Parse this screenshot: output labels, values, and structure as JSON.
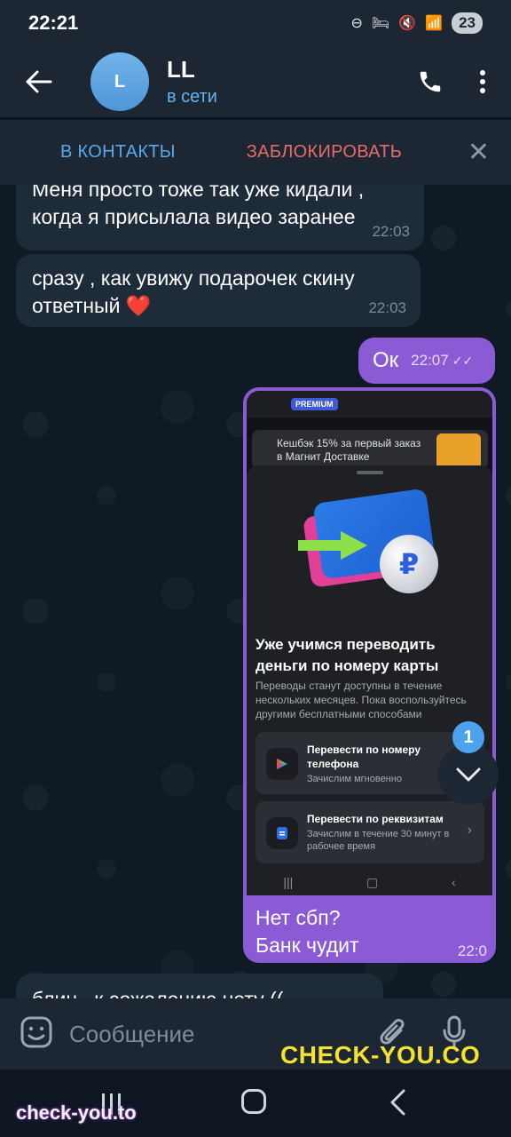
{
  "status_bar": {
    "time": "22:21",
    "battery": "23",
    "icons": [
      "do-not-disturb-icon",
      "bed-icon",
      "mute-icon",
      "wifi-icon",
      "signal-icon"
    ]
  },
  "header": {
    "avatar_letter": "L",
    "name": "LL",
    "status": "в сети",
    "accent": "#62b5f2"
  },
  "action_bar": {
    "add_contact": "В КОНТАКТЫ",
    "block": "ЗАБЛОКИРОВАТЬ"
  },
  "messages": {
    "m1": {
      "text": "Меня просто тоже так уже кидали , когда я присылала видео заранее",
      "time": "22:03"
    },
    "m2": {
      "text": "сразу , как увижу подарочек скину ответный ❤️",
      "time": "22:03"
    },
    "m3": {
      "text": "Ок",
      "time": "22:07"
    },
    "m4": {
      "caption": "Нет сбп?\nБанк чудит",
      "time": "22:0",
      "screenshot": {
        "badge": "PREMIUM",
        "promo": "Кешбэк 15% за первый заказ в Магнит Доставке",
        "title": "Уже учимся переводить деньги по номеру карты",
        "description": "Переводы станут доступны в течение нескольких месяцев. Пока воспользуйтесь другими бесплатными способами",
        "option1_title": "Перевести по номеру телефона",
        "option1_sub": "Зачислим мгновенно",
        "option2_title": "Перевести по реквизитам",
        "option2_sub": "Зачислим в течение 30 минут в рабочее время",
        "coin_symbol": "₽"
      }
    },
    "m5": {
      "text": "блин , к сожалению нету (("
    }
  },
  "unread_count": "1",
  "composer": {
    "placeholder": "Сообщение"
  },
  "watermarks": {
    "big": "CHECK-YOU.CO",
    "small": "check-you.to"
  },
  "colors": {
    "outgoing_bubble": "#8b5bd6",
    "incoming_bubble": "#1e2c3a",
    "watermark": "#f5e22c"
  }
}
